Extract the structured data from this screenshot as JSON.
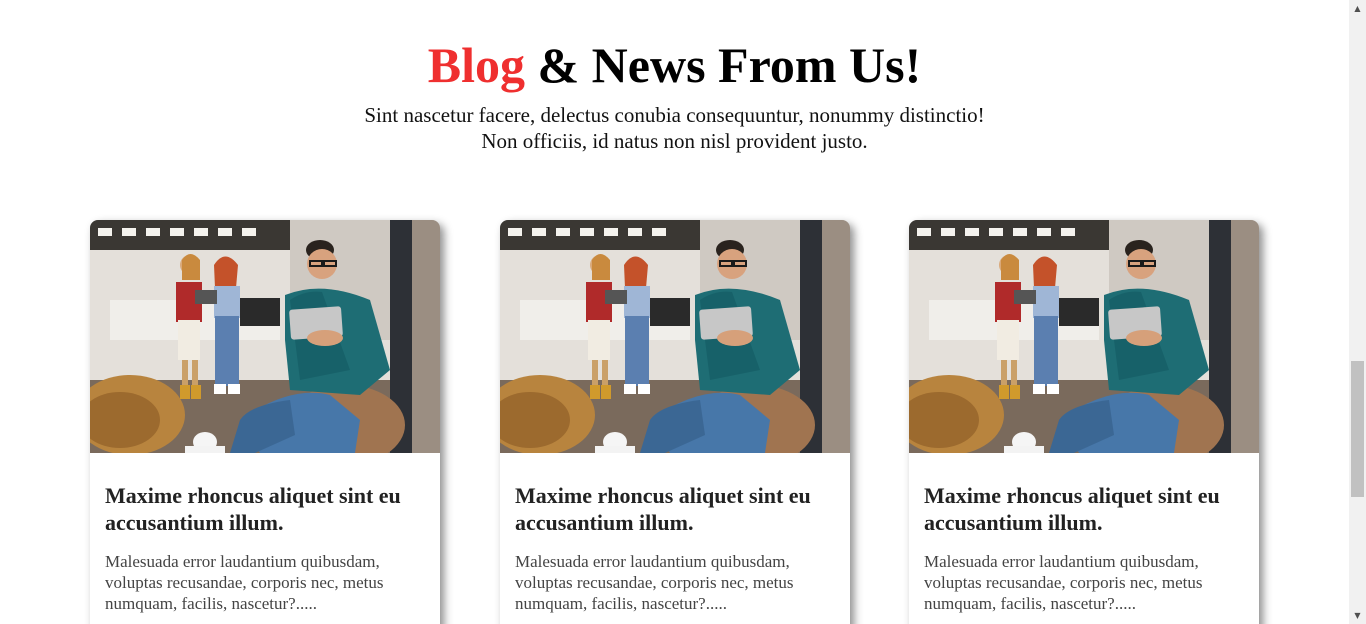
{
  "header": {
    "title_accent": "Blog",
    "title_rest": "& News From Us!",
    "subtitle_line1": "Sint nascetur facere, delectus conubia consequuntur, nonummy distinctio!",
    "subtitle_line2": "Non officiis, id natus non nisl provident justo."
  },
  "colors": {
    "accent": "#ef2f2f",
    "heading": "#000000",
    "card_title": "#222222",
    "card_text": "#444444"
  },
  "cards": [
    {
      "image": "office-people-tablet-photo",
      "title": "Maxime rhoncus aliquet sint eu accusantium illum.",
      "text": "Malesuada error laudantium quibusdam, voluptas recusandae, corporis nec, metus numquam, facilis, nascetur?....."
    },
    {
      "image": "office-people-tablet-photo",
      "title": "Maxime rhoncus aliquet sint eu accusantium illum.",
      "text": "Malesuada error laudantium quibusdam, voluptas recusandae, corporis nec, metus numquam, facilis, nascetur?....."
    },
    {
      "image": "office-people-tablet-photo",
      "title": "Maxime rhoncus aliquet sint eu accusantium illum.",
      "text": "Malesuada error laudantium quibusdam, voluptas recusandae, corporis nec, metus numquam, facilis, nascetur?....."
    }
  ],
  "scrollbar": {
    "up_icon": "chevron-up-icon",
    "down_icon": "chevron-down-icon"
  }
}
